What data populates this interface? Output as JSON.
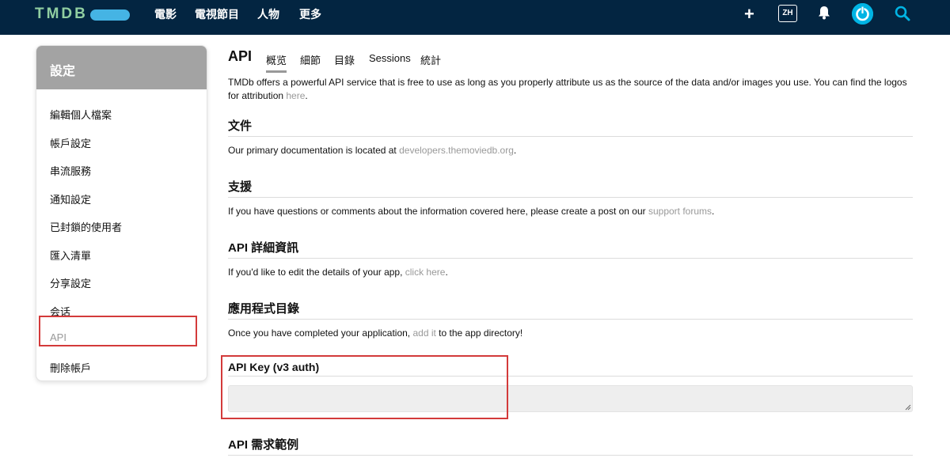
{
  "nav": {
    "logo_text": "TMDB",
    "links": [
      "電影",
      "電視節目",
      "人物",
      "更多"
    ],
    "lang": "ZH"
  },
  "sidebar": {
    "title": "設定",
    "items": [
      {
        "label": "編輯個人檔案"
      },
      {
        "label": "帳戶設定"
      },
      {
        "label": "串流服務"
      },
      {
        "label": "通知設定"
      },
      {
        "label": "已封鎖的使用者"
      },
      {
        "label": "匯入清單"
      },
      {
        "label": "分享設定"
      },
      {
        "label": "会话"
      },
      {
        "label": "API"
      },
      {
        "label": "刪除帳戶"
      }
    ]
  },
  "main": {
    "title": "API",
    "tabs": [
      "概览",
      "細節",
      "目錄",
      "Sessions",
      "統計"
    ],
    "intro_text": "TMDb offers a powerful API service that is free to use as long as you properly attribute us as the source of the data and/or images you use. You can find the logos for attribution ",
    "intro_link": "here",
    "intro_end": ".",
    "sections": [
      {
        "heading": "文件",
        "text": "Our primary documentation is located at ",
        "link": "developers.themoviedb.org",
        "text_after": "."
      },
      {
        "heading": "支援",
        "text": "If you have questions or comments about the information covered here, please create a post on our ",
        "link": "support forums",
        "text_after": "."
      },
      {
        "heading": "API 詳細資訊",
        "text": "If you'd like to edit the details of your app, ",
        "link": "click here",
        "text_after": "."
      },
      {
        "heading": "應用程式目錄",
        "text": "Once you have completed your application, ",
        "link": "add it",
        "text_after": " to the app directory!"
      }
    ],
    "api_key_heading": "API Key (v3 auth)",
    "api_key_value": "",
    "request_example_heading": "API 需求範例"
  },
  "colors": {
    "nav_bg": "#032541",
    "logo_green": "#90cea1",
    "logo_blue": "#45b4e4",
    "sidebar_header": "#a3a3a3",
    "highlight_red": "#d33a3a",
    "link_gray": "#999999"
  },
  "icons": [
    "plus-icon",
    "bell-icon",
    "avatar",
    "search-icon",
    "resize-grip-icon"
  ]
}
